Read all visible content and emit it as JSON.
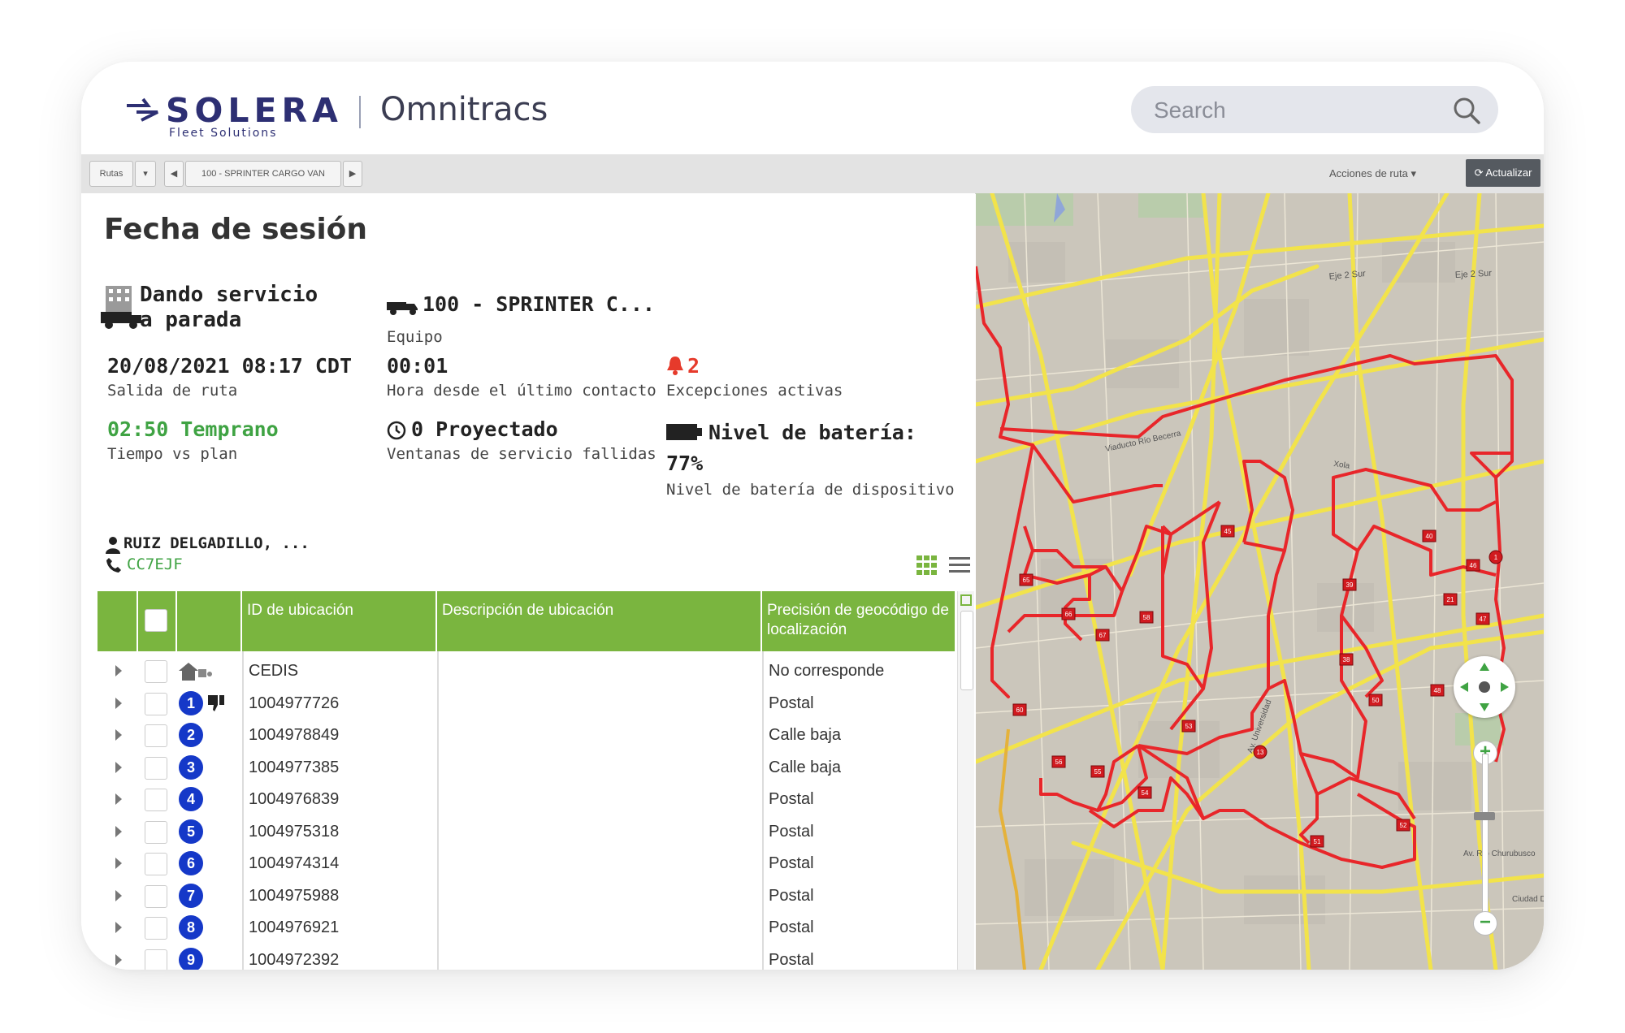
{
  "header": {
    "brand": "SOLERA",
    "brand_sub": "Fleet Solutions",
    "product": "Omnitracs",
    "search_placeholder": "Search"
  },
  "toolbar": {
    "rutas_label": "Rutas",
    "route_name": "100 - SPRINTER CARGO VAN",
    "acciones_label": "Acciones de ruta ▾",
    "actualizar_label": "Actualizar"
  },
  "session": {
    "title": "Fecha de sesión",
    "status": "Dando servicio a parada",
    "equipment_value": "100 - SPRINTER C...",
    "equipment_label": "Equipo",
    "departure_value": "20/08/2021 08:17 CDT",
    "departure_label": "Salida de ruta",
    "last_contact_value": "00:01",
    "last_contact_label": "Hora desde el último contacto",
    "exceptions_value": "2",
    "exceptions_label": "Excepciones activas",
    "time_plan_value": "02:50 Temprano",
    "time_plan_label": "Tiempo vs plan",
    "projected_value": "0 Proyectado",
    "projected_label": "Ventanas de servicio fallidas",
    "battery_value_line1": "Nivel de batería:",
    "battery_value_line2": "77%",
    "battery_label": "Nivel de batería de dispositivo",
    "driver_name": "RUIZ DELGADILLO, ...",
    "driver_phone": "CC7EJF"
  },
  "table": {
    "headers": [
      "ID de ubicación",
      "Descripción de ubicación",
      "Precisión de geocódigo de localización"
    ],
    "rows": [
      {
        "marker": "home",
        "id": "CEDIS",
        "desc": "",
        "precision": "No corresponde"
      },
      {
        "marker": "1",
        "id": "1004977726",
        "desc": "",
        "precision": "Postal"
      },
      {
        "marker": "2",
        "id": "1004978849",
        "desc": "",
        "precision": "Calle baja"
      },
      {
        "marker": "3",
        "id": "1004977385",
        "desc": "",
        "precision": "Calle baja"
      },
      {
        "marker": "4",
        "id": "1004976839",
        "desc": "",
        "precision": "Postal"
      },
      {
        "marker": "5",
        "id": "1004975318",
        "desc": "",
        "precision": "Postal"
      },
      {
        "marker": "6",
        "id": "1004974314",
        "desc": "",
        "precision": "Postal"
      },
      {
        "marker": "7",
        "id": "1004975988",
        "desc": "",
        "precision": "Postal"
      },
      {
        "marker": "8",
        "id": "1004976921",
        "desc": "",
        "precision": "Postal"
      },
      {
        "marker": "9",
        "id": "1004972392",
        "desc": "",
        "precision": "Postal"
      }
    ]
  },
  "map": {
    "route_color": "#e8262a",
    "road_color": "#f2e34b",
    "stop_labels": [
      "1",
      "21",
      "40",
      "45",
      "39",
      "38",
      "65",
      "66",
      "67",
      "58",
      "60",
      "56",
      "55",
      "54",
      "53",
      "13",
      "50",
      "51",
      "52",
      "48",
      "47",
      "46"
    ],
    "street_labels": [
      "Eje 2 Sur",
      "Eje 2 Sur",
      "Viaducto Río Becerra",
      "Xola",
      "Av. Universidad",
      "Av. Río Churubusco",
      "Ciudad De"
    ]
  },
  "colors": {
    "brand_navy": "#2d2f73",
    "table_header_green": "#7ab53f",
    "accent_green": "#3fa343",
    "alert_red": "#e63a2b",
    "stop_badge_blue": "#1538c8"
  }
}
